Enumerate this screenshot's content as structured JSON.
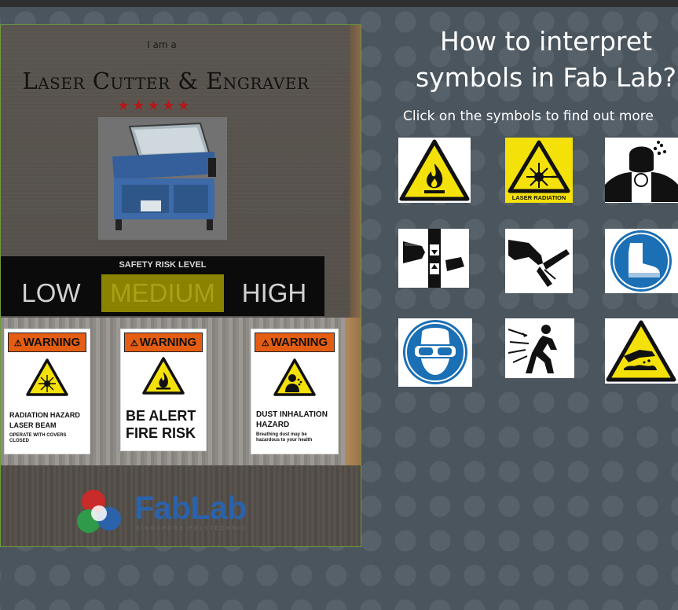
{
  "poster": {
    "intro": "I am a",
    "title": "Laser Cutter & Engraver",
    "stars": "★★★★★",
    "risk": {
      "label": "SAFETY RISK LEVEL",
      "low": "LOW",
      "medium": "MEDIUM",
      "high": "HIGH",
      "selected": "MEDIUM"
    },
    "signs": [
      {
        "header": "WARNING",
        "line1": "RADIATION HAZARD",
        "line2": "LASER BEAM",
        "line3": "OPERATE WITH COVERS CLOSED",
        "icon": "laser-radiation-icon"
      },
      {
        "header": "WARNING",
        "line1": "BE ALERT",
        "line2": "FIRE RISK",
        "line3": "",
        "icon": "flammable-icon"
      },
      {
        "header": "WARNING",
        "line1": "DUST INHALATION",
        "line2": "HAZARD",
        "line3": "Breathing dust may be hazardous to your health",
        "icon": "dust-inhalation-icon"
      }
    ],
    "logo": {
      "name": "FabLab",
      "sub": "SINGAPORE POLYTECHNIC"
    }
  },
  "panel": {
    "heading_line1": "How to interpret",
    "heading_line2": "symbols in Fab Lab?",
    "subheading": "Click on the symbols to find out more",
    "symbols": [
      {
        "icon": "flammable-warning-icon"
      },
      {
        "icon": "laser-radiation-warning-icon",
        "caption": "LASER RADIATION"
      },
      {
        "icon": "dust-mask-hazard-icon"
      },
      {
        "icon": "hand-crush-hazard-icon"
      },
      {
        "icon": "hand-cut-hazard-icon"
      },
      {
        "icon": "safety-boots-icon"
      },
      {
        "icon": "safety-goggles-icon"
      },
      {
        "icon": "flying-debris-hazard-icon"
      },
      {
        "icon": "corrosive-hazard-icon"
      }
    ]
  },
  "colors": {
    "background": "#4a555e",
    "warning_orange": "#e55d13",
    "hazard_yellow": "#f5e10a",
    "mandatory_blue": "#1b6fb4",
    "star_red": "#b11a1a",
    "medium_highlight": "#8a8300",
    "fablab_blue": "#2a62ab"
  }
}
